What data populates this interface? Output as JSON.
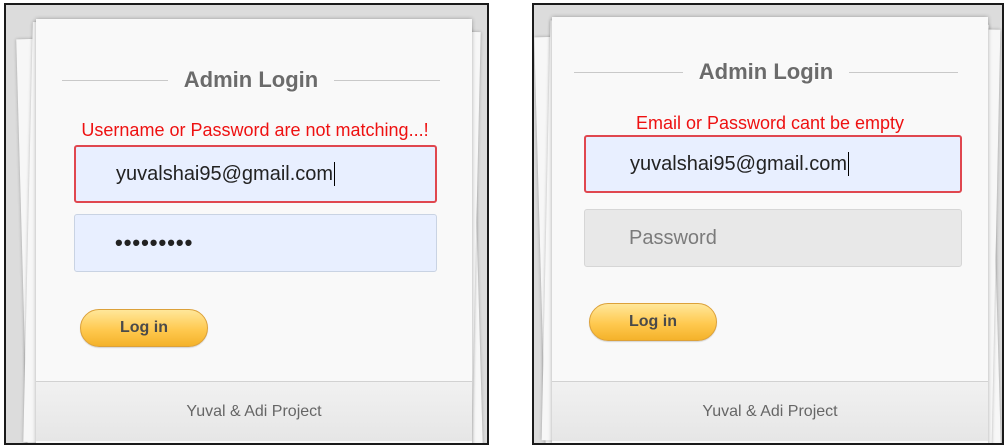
{
  "left": {
    "title": "Admin Login",
    "error": "Username or Password are not matching...!",
    "email_value": "yuvalshai95@gmail.com",
    "password_masked": "•••••••••",
    "login_label": "Log in",
    "footer": "Yuval & Adi Project"
  },
  "right": {
    "title": "Admin Login",
    "error": "Email or Password cant be empty",
    "email_value": "yuvalshai95@gmail.com",
    "password_placeholder": "Password",
    "login_label": "Log in",
    "footer": "Yuval & Adi Project"
  },
  "colors": {
    "error_text": "#ee1111",
    "error_border": "#e0474f",
    "input_fill": "#e8efff",
    "button_gradient": [
      "#ffe79a",
      "#f4b22a"
    ]
  }
}
